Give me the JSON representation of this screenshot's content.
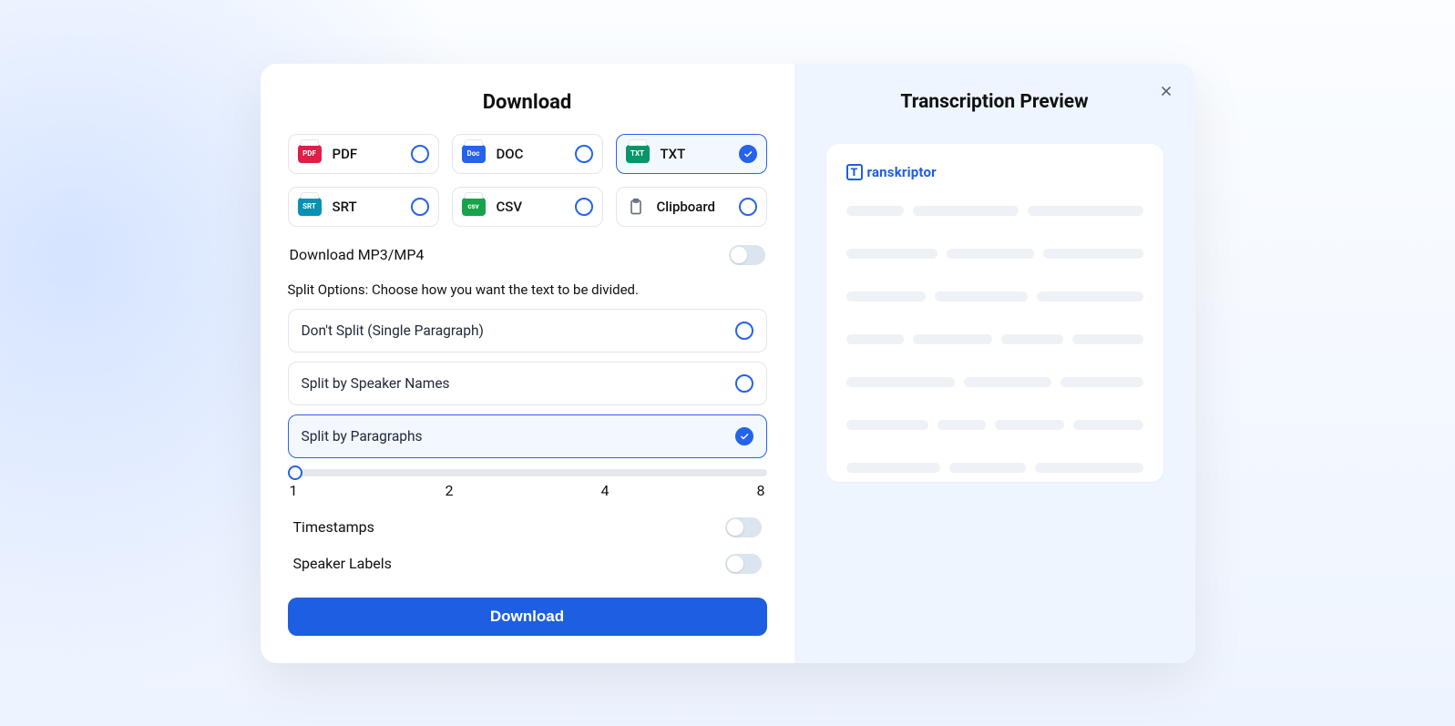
{
  "left": {
    "title": "Download",
    "formats": [
      {
        "key": "pdf",
        "label": "PDF",
        "selected": false,
        "badgeClass": "badge-pdf"
      },
      {
        "key": "doc",
        "label": "DOC",
        "selected": false,
        "badgeClass": "badge-doc"
      },
      {
        "key": "txt",
        "label": "TXT",
        "selected": true,
        "badgeClass": "badge-txt"
      },
      {
        "key": "srt",
        "label": "SRT",
        "selected": false,
        "badgeClass": "badge-srt"
      },
      {
        "key": "csv",
        "label": "CSV",
        "selected": false,
        "badgeClass": "badge-csv"
      },
      {
        "key": "clipboard",
        "label": "Clipboard",
        "selected": false,
        "isClipboard": true
      }
    ],
    "mp3mp4": {
      "label": "Download MP3/MP4",
      "on": false
    },
    "split": {
      "label": "Split Options: Choose how you want the text to be divided.",
      "options": [
        {
          "label": "Don't Split (Single Paragraph)",
          "selected": false
        },
        {
          "label": "Split by Speaker Names",
          "selected": false
        },
        {
          "label": "Split by Paragraphs",
          "selected": true
        }
      ],
      "sliderLabels": [
        "1",
        "2",
        "4",
        "8"
      ]
    },
    "timestamps": {
      "label": "Timestamps",
      "on": false
    },
    "speakerLabels": {
      "label": "Speaker Labels",
      "on": false
    },
    "button": "Download"
  },
  "right": {
    "title": "Transcription Preview",
    "brand": "ranskriptor",
    "brandLetter": "T",
    "skeleton": [
      [
        65,
        120,
        130
      ],
      [
        105,
        100,
        115
      ],
      [
        90,
        105,
        120
      ],
      [
        65,
        90,
        70,
        80
      ],
      [
        125,
        100,
        95
      ],
      [
        95,
        55,
        80,
        80
      ],
      [
        105,
        85,
        120
      ]
    ]
  }
}
